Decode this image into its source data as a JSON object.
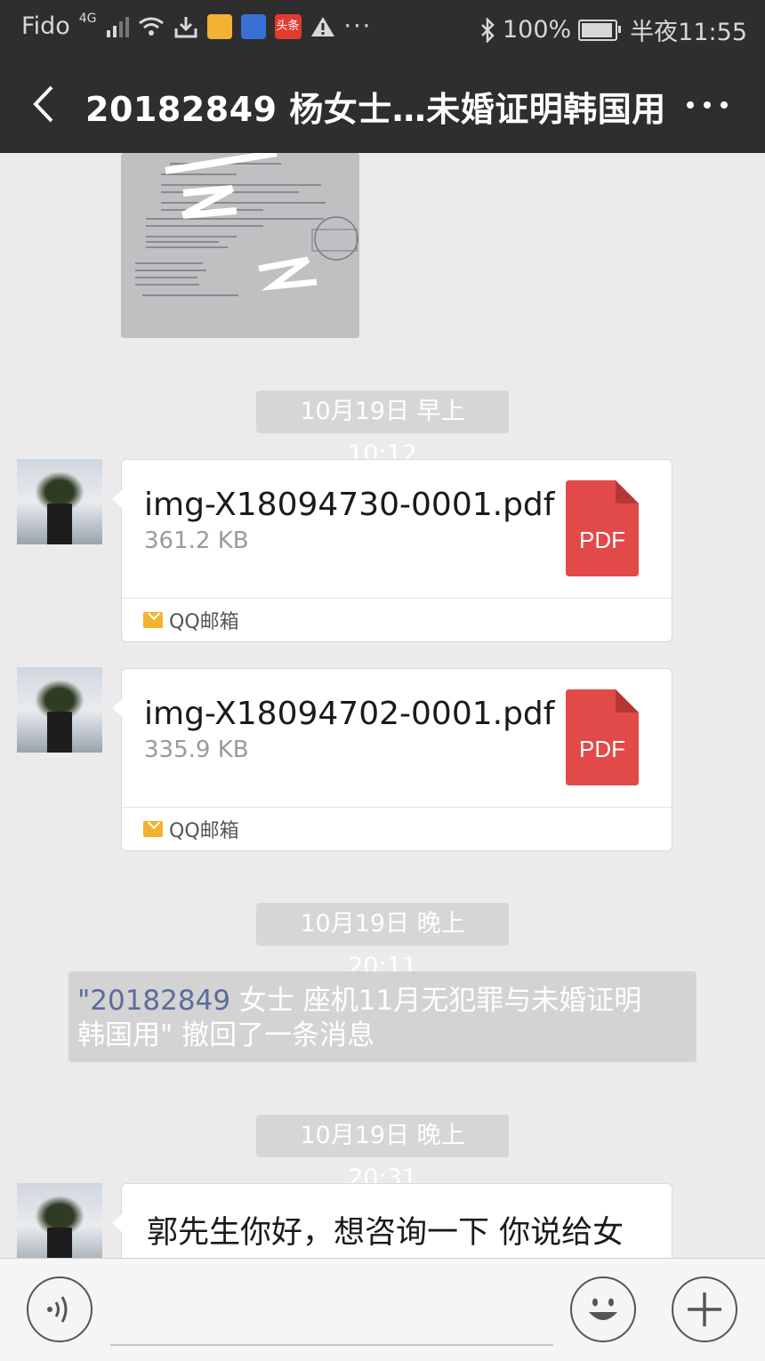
{
  "status_bar": {
    "carrier": "Fido",
    "network": "4G",
    "battery": "100%",
    "time": "半夜11:55",
    "app_badge": "头条"
  },
  "header": {
    "title": "20182849 杨女士…未婚证明韩国用"
  },
  "messages": [
    {
      "type": "timestamp",
      "text": "10月19日 早上10:12"
    },
    {
      "type": "file",
      "filename": "img-X18094730-0001.pdf",
      "size": "361.2 KB",
      "badge": "PDF",
      "source": "QQ邮箱"
    },
    {
      "type": "file",
      "filename": "img-X18094702-0001.pdf",
      "size": "335.9 KB",
      "badge": "PDF",
      "source": "QQ邮箱"
    },
    {
      "type": "timestamp",
      "text": "10月19日 晚上20:11"
    },
    {
      "type": "recall",
      "quoted": "\"20182849 ",
      "rest": "女士 座机11月无犯罪与未婚证明",
      "line2_quoted": "韩国用\"",
      "line2_rest": " 撤回了一条消息"
    },
    {
      "type": "timestamp",
      "text": "10月19日 晚上20:31"
    },
    {
      "type": "text",
      "text": "郭先生你好，想咨询一下 你说给女"
    }
  ],
  "colors": {
    "bar": "#2e2e2e",
    "background": "#ebebeb",
    "pdf_red": "#e24a4a",
    "recall_link": "#5b6e9a"
  }
}
